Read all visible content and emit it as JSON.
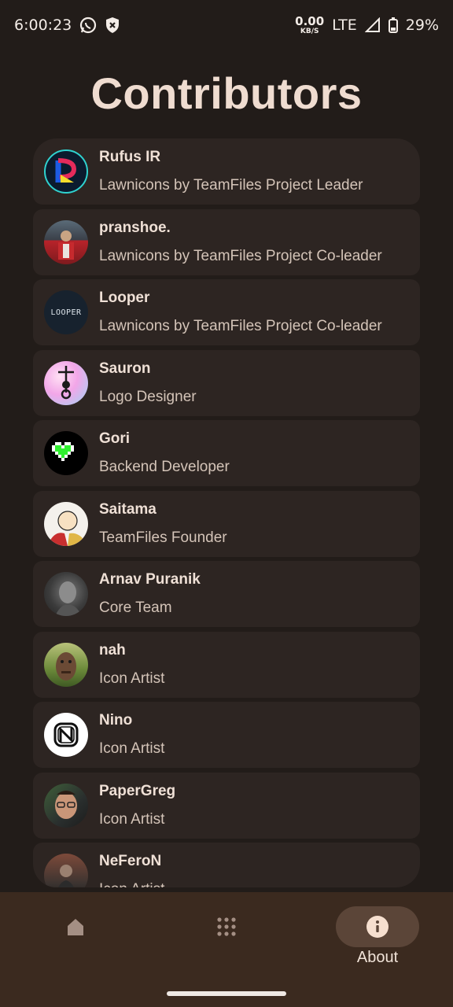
{
  "status": {
    "time": "6:00:23",
    "net_value": "0.00",
    "net_unit": "KB/S",
    "network": "LTE",
    "battery": "29%"
  },
  "title": "Contributors",
  "contributors": [
    {
      "name": "Rufus IR",
      "role": "Lawnicons by TeamFiles Project Leader"
    },
    {
      "name": "pranshoe.",
      "role": "Lawnicons by TeamFiles Project Co-leader"
    },
    {
      "name": "Looper",
      "role": "Lawnicons by TeamFiles Project Co-leader",
      "avatar_text": "LOOPER"
    },
    {
      "name": "Sauron",
      "role": "Logo Designer"
    },
    {
      "name": "Gori",
      "role": "Backend Developer"
    },
    {
      "name": "Saitama",
      "role": "TeamFiles Founder"
    },
    {
      "name": "Arnav Puranik",
      "role": "Core Team"
    },
    {
      "name": "nah",
      "role": "Icon Artist"
    },
    {
      "name": "Nino",
      "role": "Icon Artist"
    },
    {
      "name": "PaperGreg",
      "role": "Icon Artist"
    },
    {
      "name": "NeFeroN",
      "role": "Icon Artist"
    }
  ],
  "nav": {
    "items": [
      {
        "icon": "home-icon"
      },
      {
        "icon": "apps-grid-icon"
      },
      {
        "icon": "info-icon",
        "label": "About"
      }
    ]
  },
  "colors": {
    "background": "#221c19",
    "card": "#2d2522",
    "nav_background": "#3b2a1f",
    "nav_active_pill": "#5b4538"
  }
}
